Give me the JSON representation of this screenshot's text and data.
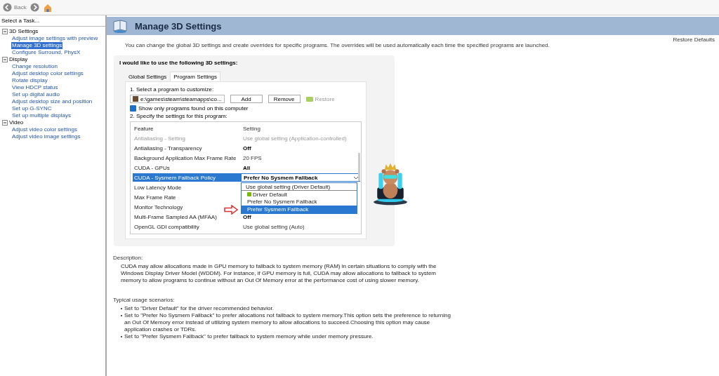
{
  "toolbar": {
    "back_label": "Back"
  },
  "sidebar": {
    "title": "Select a Task...",
    "tree": [
      {
        "label": "3D Settings",
        "expanded": true,
        "children": [
          {
            "label": "Adjust image settings with preview",
            "selected": false
          },
          {
            "label": "Manage 3D settings",
            "selected": true
          },
          {
            "label": "Configure Surround, PhysX",
            "selected": false
          }
        ]
      },
      {
        "label": "Display",
        "expanded": true,
        "children": [
          {
            "label": "Change resolution",
            "selected": false
          },
          {
            "label": "Adjust desktop color settings",
            "selected": false
          },
          {
            "label": "Rotate display",
            "selected": false
          },
          {
            "label": "View HDCP status",
            "selected": false
          },
          {
            "label": "Set up digital audio",
            "selected": false
          },
          {
            "label": "Adjust desktop size and position",
            "selected": false
          },
          {
            "label": "Set up G-SYNC",
            "selected": false
          },
          {
            "label": "Set up multiple displays",
            "selected": false
          }
        ]
      },
      {
        "label": "Video",
        "expanded": true,
        "children": [
          {
            "label": "Adjust video color settings",
            "selected": false
          },
          {
            "label": "Adjust video image settings",
            "selected": false
          }
        ]
      }
    ]
  },
  "header": {
    "title": "Manage 3D Settings",
    "restore": "Restore Defaults"
  },
  "intro": "You can change the global 3D settings and create overrides for specific programs. The overrides will be used automatically each time the specified programs are launched.",
  "group": {
    "title": "I would like to use the following 3D settings:",
    "tabs": [
      {
        "label": "Global Settings",
        "selected": false
      },
      {
        "label": "Program Settings",
        "selected": true
      }
    ],
    "step1": "1. Select a program to customize:",
    "program": "e:\\games\\steam\\steamapps\\co...",
    "add": "Add",
    "remove": "Remove",
    "restore": "Restore",
    "restore_disabled": true,
    "show_only": {
      "label": "Show only programs found on this computer",
      "checked": true
    },
    "step2": "2. Specify the settings for this program:",
    "columns": [
      "Feature",
      "Setting"
    ],
    "rows": [
      {
        "feature": "Antialiasing - Setting",
        "setting": "Use global setting (Application-controlled)",
        "disabled": true,
        "modified": false,
        "selected": false
      },
      {
        "feature": "Antialiasing - Transparency",
        "setting": "Off",
        "disabled": false,
        "modified": true,
        "selected": false
      },
      {
        "feature": "Background Application Max Frame Rate",
        "setting": "20 FPS",
        "disabled": false,
        "modified": false,
        "selected": false
      },
      {
        "feature": "CUDA - GPUs",
        "setting": "All",
        "disabled": false,
        "modified": true,
        "selected": false
      },
      {
        "feature": "CUDA - Sysmem Fallback Policy",
        "setting": "Prefer No Sysmem Fallback",
        "disabled": false,
        "modified": true,
        "selected": true
      },
      {
        "feature": "Low Latency Mode",
        "disabled": false,
        "selected": false
      },
      {
        "feature": "Max Frame Rate",
        "disabled": false,
        "selected": false
      },
      {
        "feature": "Monitor Technology",
        "disabled": false,
        "selected": false
      },
      {
        "feature": "Multi-Frame Sampled AA (MFAA)",
        "setting": "Off",
        "disabled": false,
        "modified": true,
        "selected": false
      },
      {
        "feature": "OpenGL GDI compatibility",
        "setting": "Use global setting (Auto)",
        "disabled": false,
        "modified": false,
        "selected": false
      }
    ],
    "dropdown": [
      {
        "label": "Use global setting (Driver Default)",
        "selected": false,
        "recommended": false
      },
      {
        "label": "Driver Default",
        "selected": false,
        "recommended": true
      },
      {
        "label": "Prefer No Sysmem Fallback",
        "selected": false,
        "recommended": false
      },
      {
        "label": "Prefer Sysmem Fallback",
        "selected": true,
        "recommended": false
      }
    ]
  },
  "description": {
    "title": "Description:",
    "text": "CUDA may allow allocations made in GPU memory to fallback to system memory (RAM) in certain situations to comply with the Windows Display Driver Model (WDDM). For instance, if GPU memory is full, CUDA may allow allocations to fallback to system memory to allow programs to continue without an Out Of Memory error at the performance cost of using slower memory."
  },
  "usage": {
    "title": "Typical usage scenarios:",
    "items": [
      "Set to \"Driver Default\" for the driver recommended behavior.",
      "Set to \"Prefer No Sysmem Fallback\" to prefer allocations not fallback to system memory.This option sets the preference to returning an Out Of Memory error instead of utilizing system memory to allow allocations to succeed.Choosing this option may cause application crashes or TDRs.",
      "Set to \"Prefer Sysmem Fallback\" to prefer fallback to system memory while under memory pressure."
    ]
  }
}
